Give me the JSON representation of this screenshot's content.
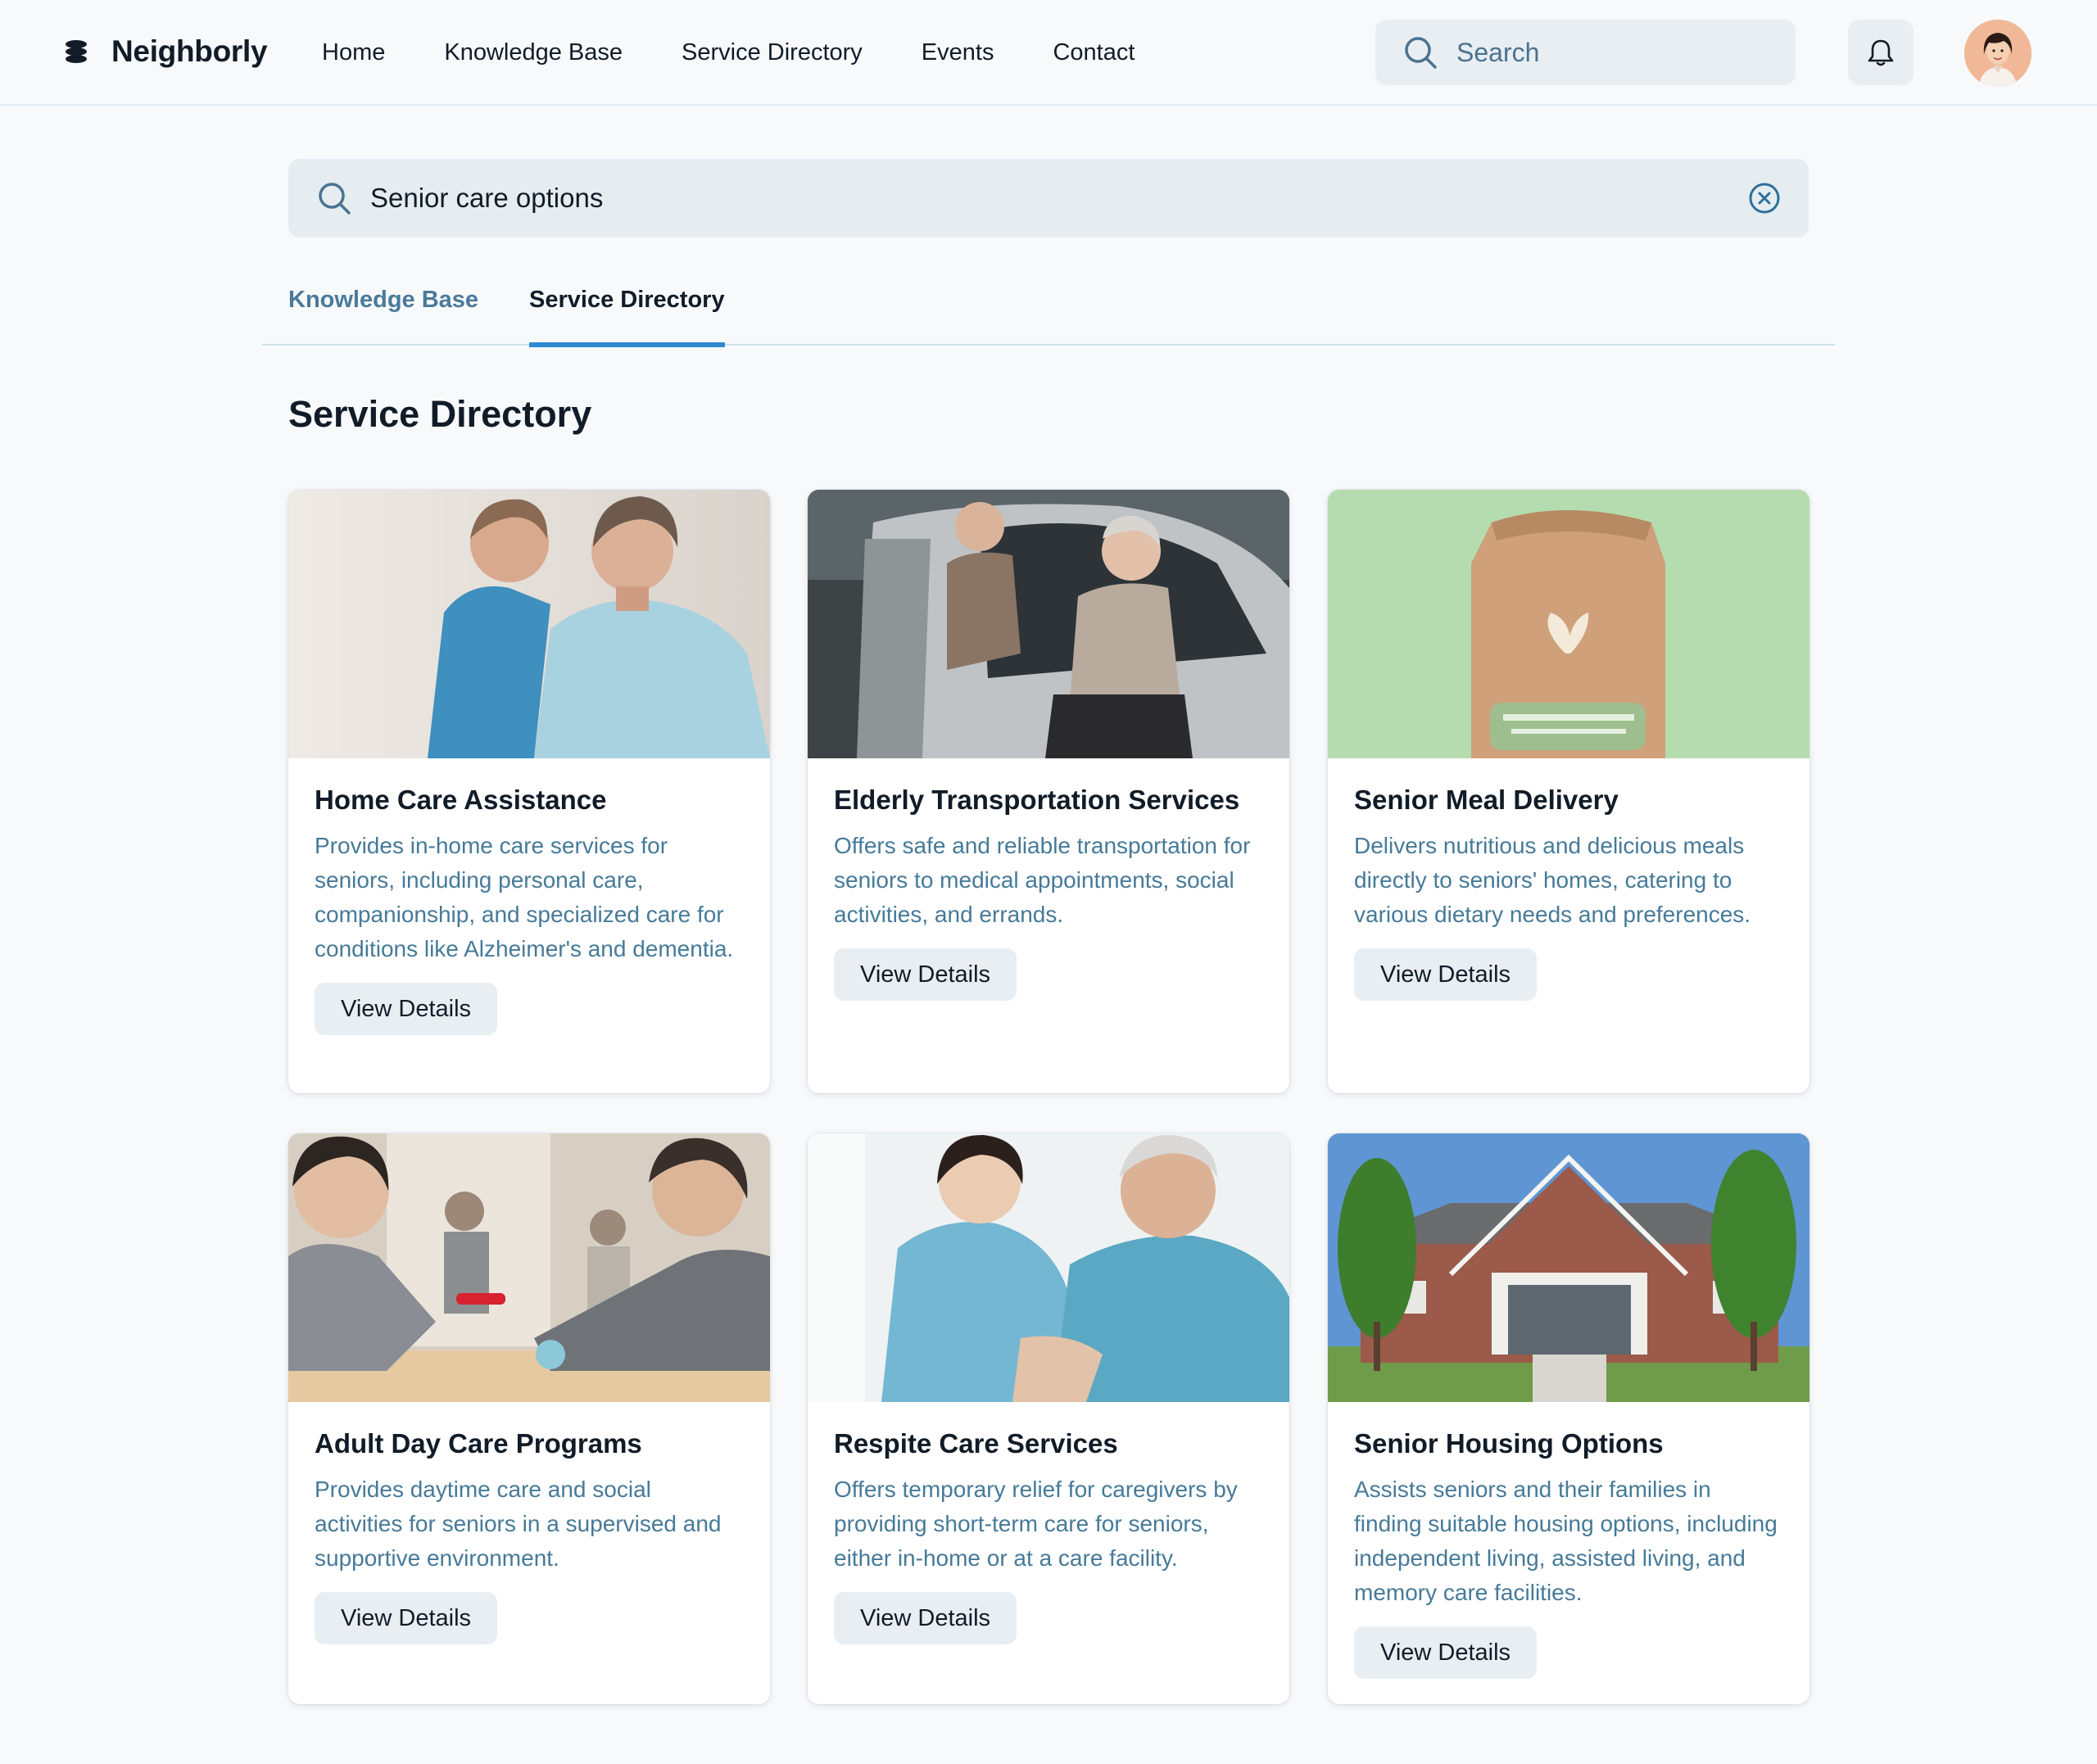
{
  "brand": {
    "name": "Neighborly"
  },
  "nav": {
    "items": [
      {
        "label": "Home"
      },
      {
        "label": "Knowledge Base"
      },
      {
        "label": "Service Directory"
      },
      {
        "label": "Events"
      },
      {
        "label": "Contact"
      }
    ]
  },
  "top_search": {
    "placeholder": "Search"
  },
  "main_search": {
    "value": "Senior care options"
  },
  "tabs": [
    {
      "label": "Knowledge Base",
      "active": false
    },
    {
      "label": "Service Directory",
      "active": true
    }
  ],
  "section_title": "Service Directory",
  "cards": [
    {
      "title": "Home Care Assistance",
      "description": "Provides in-home care services for seniors, including personal care, companionship, and specialized care for conditions like Alzheimer's and dementia.",
      "button": "View Details",
      "image": "photo-caregiver-with-senior-woman"
    },
    {
      "title": "Elderly Transportation Services",
      "description": "Offers safe and reliable transportation for seniors to medical appointments, social activities, and errands.",
      "button": "View Details",
      "image": "photo-senior-helped-into-car"
    },
    {
      "title": "Senior Meal Delivery",
      "description": "Delivers nutritious and delicious meals directly to seniors' homes, catering to various dietary needs and preferences.",
      "button": "View Details",
      "image": "photo-paper-meal-bag"
    },
    {
      "title": "Adult Day Care Programs",
      "description": "Provides daytime care and social activities for seniors in a supervised and supportive environment.",
      "button": "View Details",
      "image": "photo-seniors-activity-table"
    },
    {
      "title": "Respite Care Services",
      "description": "Offers temporary relief for caregivers by providing short-term care for seniors, either in-home or at a care facility.",
      "button": "View Details",
      "image": "photo-nurse-with-senior-man"
    },
    {
      "title": "Senior Housing Options",
      "description": "Assists seniors and their families in finding suitable housing options, including independent living, assisted living, and memory care facilities.",
      "button": "View Details",
      "image": "photo-brick-senior-residence"
    }
  ],
  "icons": {
    "logo": "stack-logo-icon",
    "search": "search-icon",
    "bell": "bell-icon",
    "clear": "clear-circle-x-icon"
  },
  "colors": {
    "accent": "#2d8ad0",
    "muted_text": "#467a98",
    "background": "#f7f9fb",
    "field": "#e8eef2"
  }
}
